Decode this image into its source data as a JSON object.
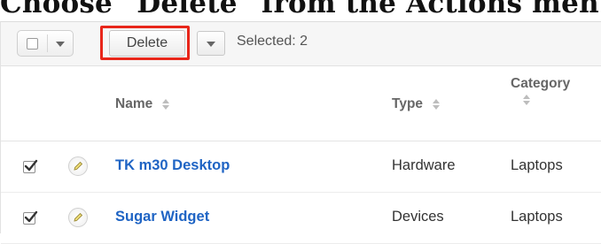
{
  "instruction": "Choose \"Delete\" from the Actions menu.",
  "toolbar": {
    "delete_label": "Delete",
    "selected_text": "Selected: 2"
  },
  "columns": {
    "name": "Name",
    "type": "Type",
    "category": "Category"
  },
  "rows": [
    {
      "name": "TK m30 Desktop",
      "type": "Hardware",
      "category": "Laptops",
      "checked": true
    },
    {
      "name": "Sugar Widget",
      "type": "Devices",
      "category": "Laptops",
      "checked": true
    }
  ],
  "colors": {
    "highlight": "#e8261a",
    "link": "#1f64c4"
  }
}
